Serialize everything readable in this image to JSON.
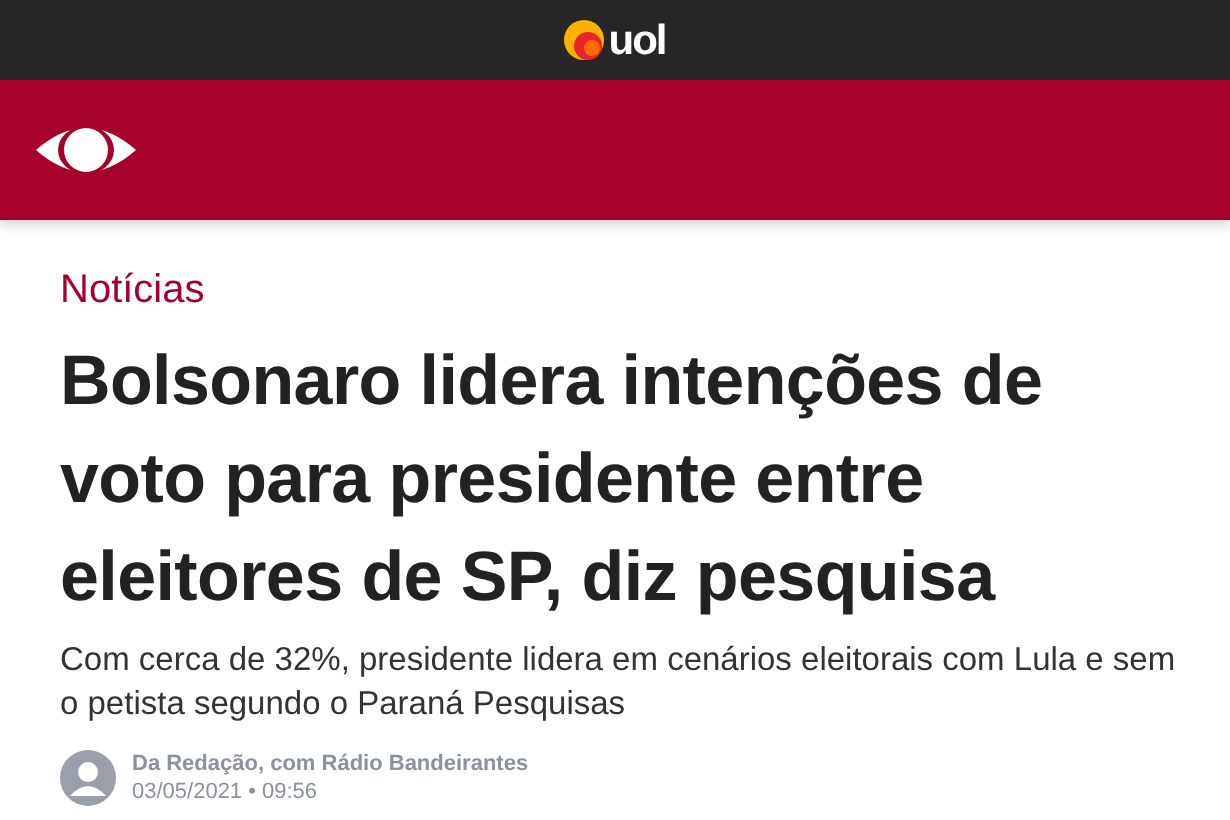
{
  "top_bar": {
    "logo_text": "uol"
  },
  "section": "Notícias",
  "headline": "Bolsonaro lidera intenções de voto para presidente entre eleitores de SP, diz pesquisa",
  "subheadline": "Com cerca de 32%, presidente lidera em cenários eleitorais com Lula e sem o petista segundo o Paraná Pesquisas",
  "byline": {
    "author": "Da Redação, com Rádio Bandeirantes",
    "date": "03/05/2021 • 09:56"
  }
}
